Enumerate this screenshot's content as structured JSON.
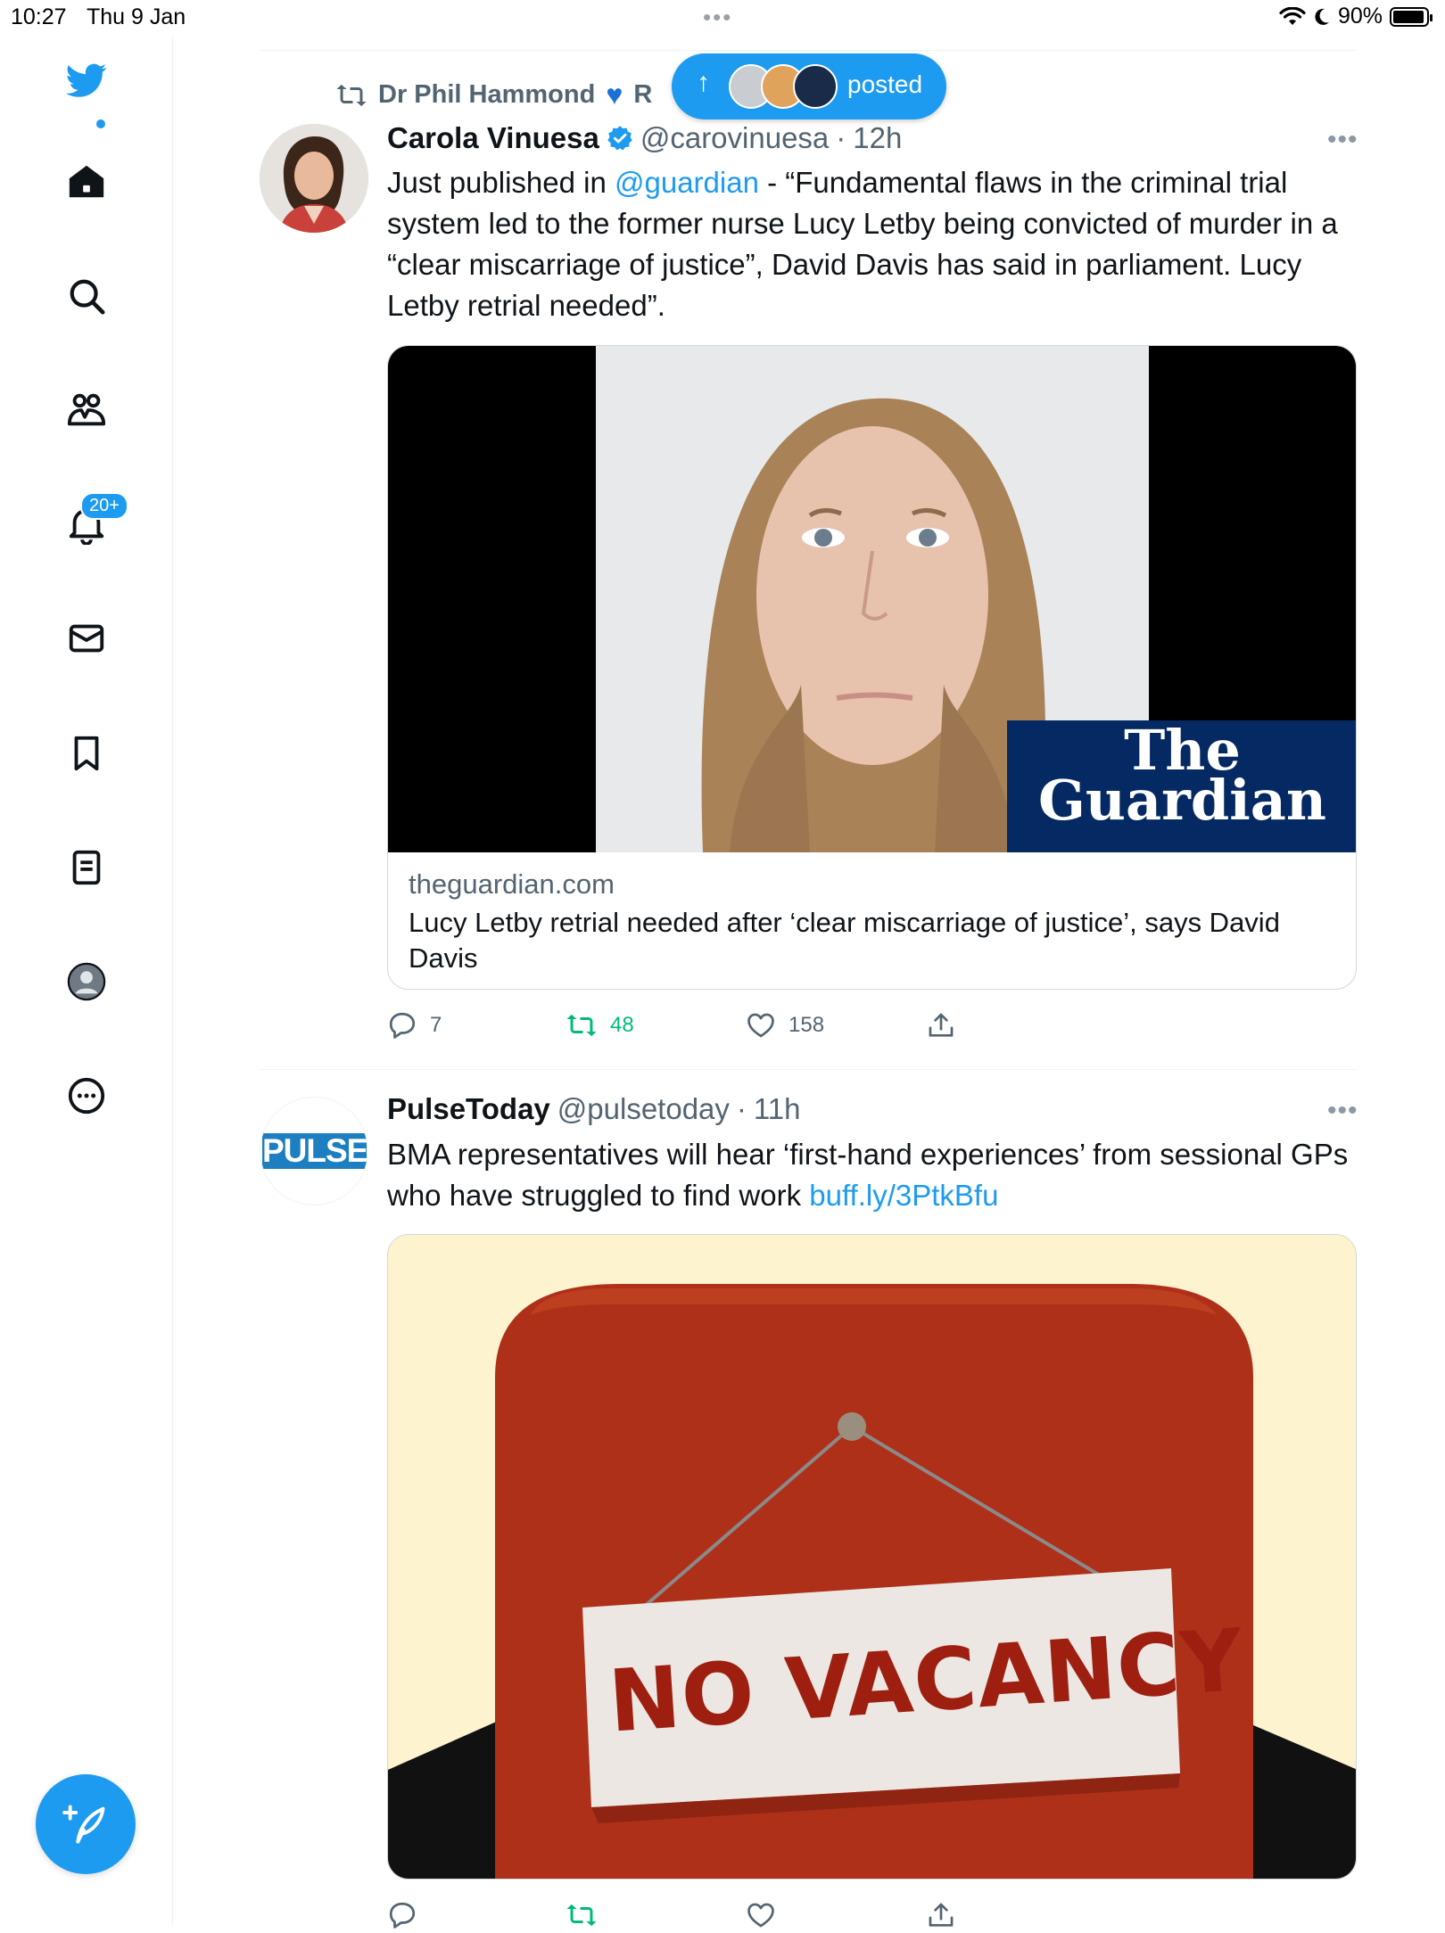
{
  "status_bar": {
    "time": "10:27",
    "date": "Thu 9 Jan",
    "battery": "90%"
  },
  "sidebar": {
    "notifications_badge": "20+"
  },
  "new_posts_pill": {
    "label": "posted"
  },
  "tweets": [
    {
      "retweeted_by": "Dr Phil Hammond",
      "retweeted_by_suffix": "R",
      "author": "Carola Vinuesa",
      "handle": "@carovinuesa",
      "time": "12h",
      "text_prefix": "Just published in ",
      "mention": "@guardian",
      "text_suffix": " - “Fundamental flaws in the criminal trial system led to the former nurse Lucy Letby being convicted of murder in a “clear miscarriage of justice”, David Davis has said in parliament. Lucy Letby retrial needed”.",
      "card": {
        "domain": "theguardian.com",
        "title": "Lucy Letby retrial needed after ‘clear miscarriage of justice’, says David Davis",
        "logo_line1": "The",
        "logo_line2": "Guardian"
      },
      "replies": "7",
      "retweets": "48",
      "likes": "158"
    },
    {
      "author": "PulseToday",
      "handle": "@pulsetoday",
      "time": "11h",
      "avatar_text": "PULSE",
      "text": "BMA representatives will hear ‘first-hand experiences’ from sessional GPs who have struggled to find work ",
      "link": "buff.ly/3PtkBfu",
      "image_sign": "NO VACANCY"
    }
  ],
  "colors": {
    "accent": "#1d9bf0",
    "retweet_green": "#00ba7c",
    "secondary_text": "#536471",
    "guardian_navy": "#052962",
    "sign_red": "#b03018"
  }
}
